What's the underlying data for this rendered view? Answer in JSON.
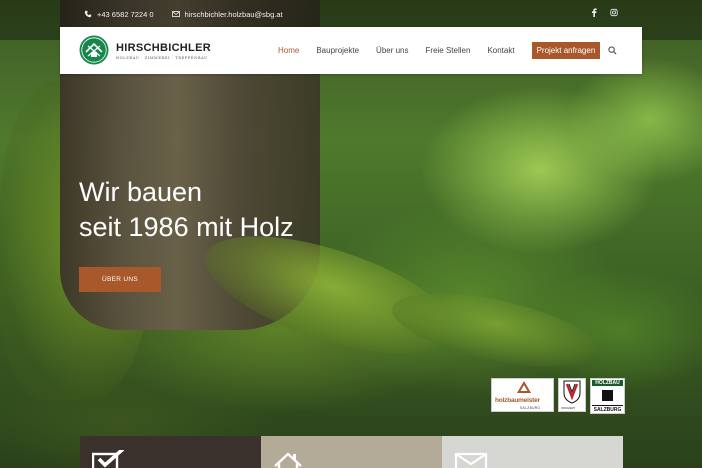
{
  "topbar": {
    "phone": "+43 6582 7224 0",
    "email": "hirschbichler.holzbau@sbg.at",
    "phone_icon": "phone-icon",
    "email_icon": "mail-icon",
    "social": [
      "facebook-icon",
      "instagram-icon"
    ]
  },
  "brand": {
    "name": "HIRSCHBICHLER",
    "tagline": "HOLZBAU · ZIMMEREI · TREPPENBAU"
  },
  "nav": {
    "items": [
      "Home",
      "Bauprojekte",
      "Über uns",
      "Freie Stellen",
      "Kontakt"
    ],
    "active": "Home",
    "cta": "Projekt anfragen",
    "search_icon": "search-icon"
  },
  "hero": {
    "headline_line1": "Wir bauen",
    "headline_line2": "seit 1986 mit Holz",
    "button": "ÜBER UNS"
  },
  "badges": {
    "holzbaumeister": "holzbaumeister",
    "holzbaumeister_sub": "SALZBURG",
    "innozert": "INNOZERT",
    "holzbau_top": "HOLZBAU",
    "holzbau_bottom": "SALZBURG"
  },
  "colors": {
    "accent": "#a8582a",
    "tile_dark": "#3a302c",
    "tile_mid": "#b3aa98",
    "tile_light": "#d6d6d2"
  },
  "tiles": [
    "check-icon",
    "house-icon",
    "envelope-icon"
  ]
}
